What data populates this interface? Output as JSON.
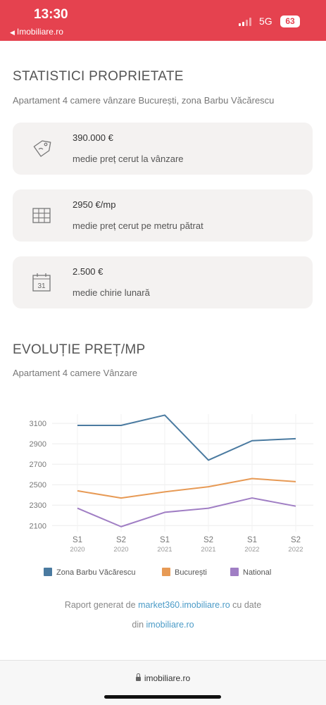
{
  "status_bar": {
    "time": "13:30",
    "back_app": "Imobiliare.ro",
    "network": "5G",
    "battery": "63"
  },
  "stats": {
    "title": "STATISTICI PROPRIETATE",
    "subtitle": "Apartament 4 camere vânzare București, zona Barbu Văcărescu",
    "cards": [
      {
        "icon": "price-tag-icon",
        "value": "390.000 €",
        "label": "medie preț cerut la vânzare"
      },
      {
        "icon": "grid-icon",
        "value": "2950 €/mp",
        "label": "medie preț cerut pe metru pătrat"
      },
      {
        "icon": "calendar-icon",
        "value": "2.500 €",
        "label": "medie chirie lunară",
        "calendar_day": "31"
      }
    ]
  },
  "evolution": {
    "title": "EVOLUȚIE PREȚ/MP",
    "subtitle": "Apartament 4 camere Vânzare"
  },
  "chart_data": {
    "type": "line",
    "categories": [
      [
        "S1",
        "2020"
      ],
      [
        "S2",
        "2020"
      ],
      [
        "S1",
        "2021"
      ],
      [
        "S2",
        "2021"
      ],
      [
        "S1",
        "2022"
      ],
      [
        "S2",
        "2022"
      ]
    ],
    "y_ticks": [
      3100,
      2900,
      2700,
      2500,
      2300,
      2100
    ],
    "ylim": [
      2040,
      3190
    ],
    "grid": true,
    "legend_position": "bottom",
    "series": [
      {
        "name": "Zona Barbu Văcărescu",
        "color": "#4a7aa0",
        "values": [
          3080,
          3080,
          3180,
          2740,
          2930,
          2950
        ]
      },
      {
        "name": "București",
        "color": "#e79a55",
        "values": [
          2440,
          2370,
          2430,
          2480,
          2560,
          2530
        ]
      },
      {
        "name": "National",
        "color": "#a07ec4",
        "values": [
          2270,
          2090,
          2230,
          2270,
          2370,
          2290
        ]
      }
    ]
  },
  "report": {
    "prefix": "Raport generat de ",
    "link": "market360.imobiliare.ro",
    "suffix": " cu date",
    "line2_prefix": "din ",
    "line2_link": "imobiliare.ro"
  },
  "browser": {
    "url": "imobiliare.ro"
  }
}
